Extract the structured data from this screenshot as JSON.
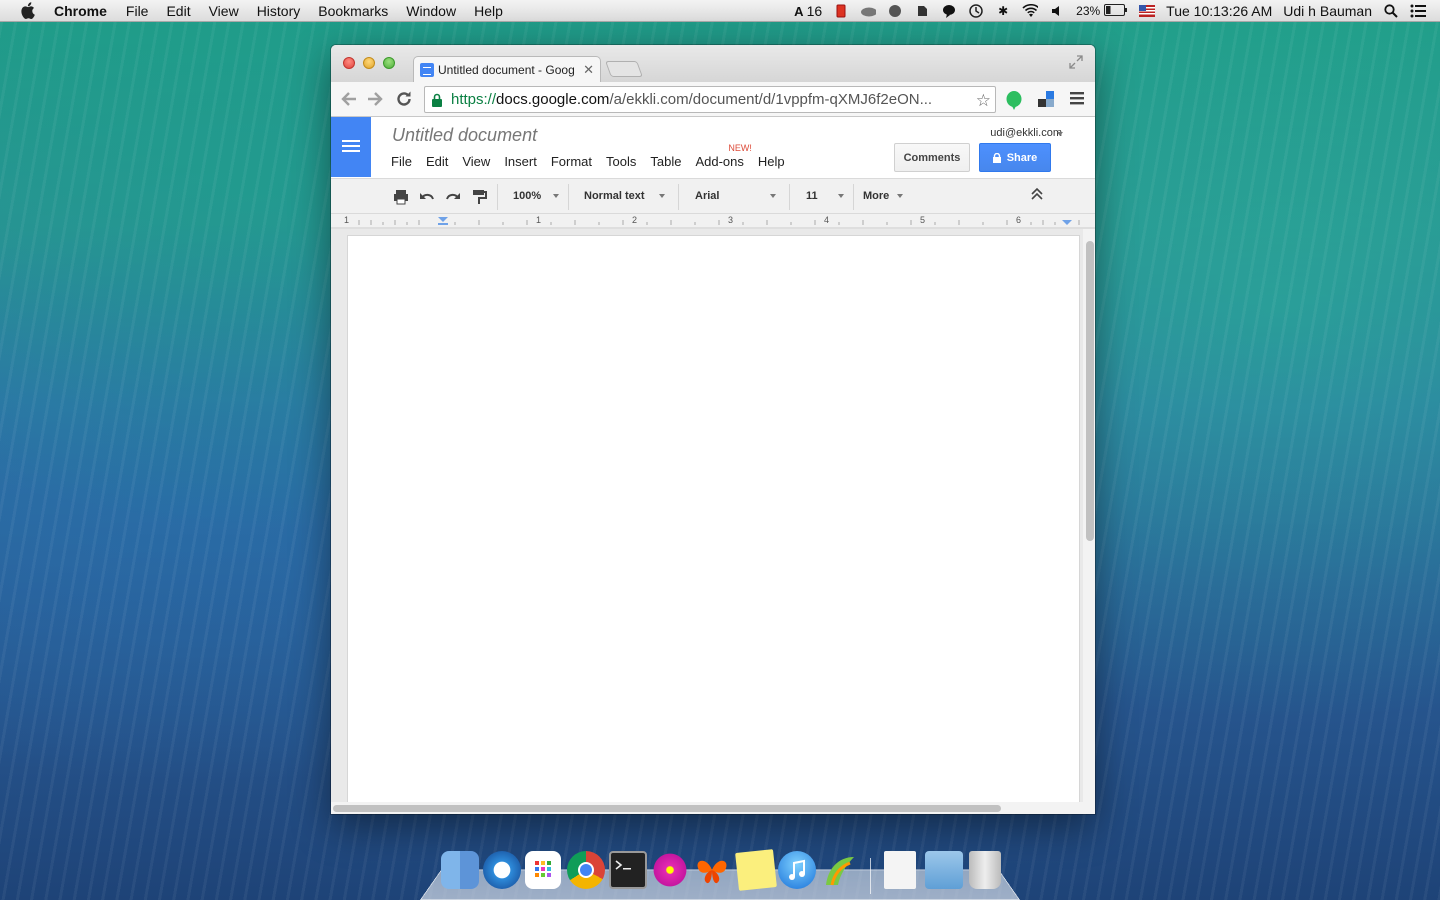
{
  "menubar": {
    "app_name": "Chrome",
    "items": [
      "File",
      "Edit",
      "View",
      "History",
      "Bookmarks",
      "Window",
      "Help"
    ],
    "status": {
      "adobe_count": "16",
      "battery": "23%",
      "clock": "Tue 10:13:26 AM",
      "user": "Udi h Bauman"
    }
  },
  "browser": {
    "tab_title": "Untitled document - Goog",
    "url": {
      "scheme": "https://",
      "domain": "docs.google.com",
      "path": "/a/ekkli.com/document/d/1vppfm-qXMJ6f2eON..."
    }
  },
  "docs": {
    "title": "Untitled document",
    "menu": [
      "File",
      "Edit",
      "View",
      "Insert",
      "Format",
      "Tools",
      "Table",
      "Add-ons",
      "Help"
    ],
    "new_badge": "NEW!",
    "account": "udi@ekkli.com",
    "comments_label": "Comments",
    "share_label": "Share",
    "toolbar": {
      "zoom": "100%",
      "style": "Normal text",
      "font": "Arial",
      "size": "11",
      "more": "More"
    },
    "ruler_labels": [
      "1",
      "1",
      "2",
      "3",
      "4",
      "5",
      "6"
    ]
  },
  "dock": {
    "items": [
      "finder-icon",
      "safari-icon",
      "launchpad-icon",
      "chrome-icon",
      "terminal-icon",
      "flower-icon",
      "butterfly-icon",
      "stickies-icon",
      "itunes-icon",
      "app-icon",
      "documents-icon",
      "folder-icon",
      "trash-icon"
    ]
  },
  "colors": {
    "docs_blue": "#4285f4",
    "share_blue": "#4d90fe",
    "secure_green": "#0b8043"
  }
}
